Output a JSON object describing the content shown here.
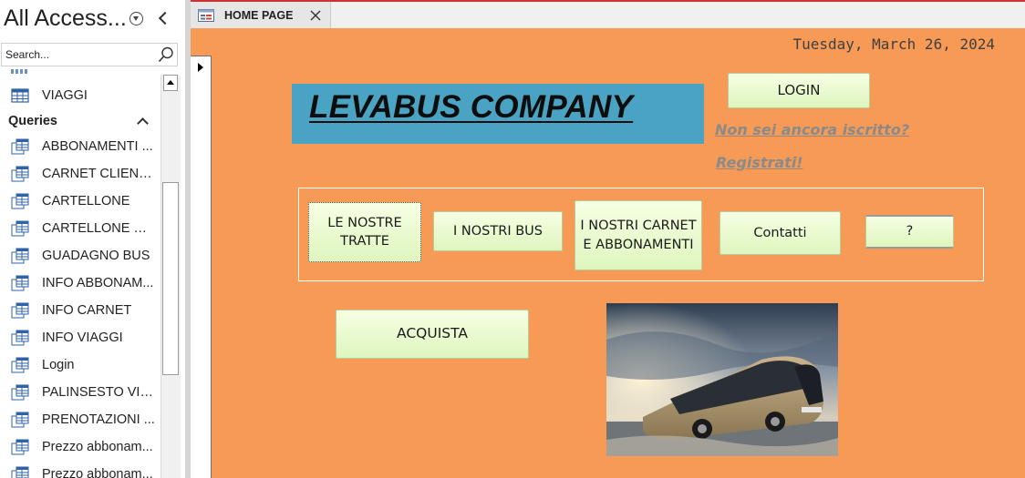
{
  "navigation_pane": {
    "title": "All Access...",
    "search_placeholder": "Search...",
    "tables": [
      {
        "label": "VIAGGI",
        "icon": "table-icon"
      }
    ],
    "queries_header": "Queries",
    "queries": [
      {
        "label": "ABBONAMENTI ...",
        "icon": "query-icon"
      },
      {
        "label": "CARNET CLIENTE",
        "icon": "query-icon"
      },
      {
        "label": "CARTELLONE",
        "icon": "query-icon"
      },
      {
        "label": "CARTELLONE VI...",
        "icon": "query-icon"
      },
      {
        "label": "GUADAGNO BUS",
        "icon": "query-icon"
      },
      {
        "label": "INFO ABBONAM...",
        "icon": "query-icon"
      },
      {
        "label": "INFO CARNET",
        "icon": "query-icon"
      },
      {
        "label": "INFO VIAGGI",
        "icon": "query-icon"
      },
      {
        "label": "Login",
        "icon": "query-icon"
      },
      {
        "label": "PALINSESTO VIA...",
        "icon": "query-icon"
      },
      {
        "label": "PRENOTAZIONI ...",
        "icon": "query-icon"
      },
      {
        "label": "Prezzo abbonam...",
        "icon": "query-icon"
      },
      {
        "label": "Prezzo abbonam...",
        "icon": "query-icon"
      }
    ]
  },
  "document_tab": {
    "label": "HOME PAGE",
    "icon": "form-icon"
  },
  "form": {
    "date": "Tuesday, March 26, 2024",
    "company_title": "LEVABUS COMPANY",
    "login_label": "LOGIN",
    "signup_prompt": "Non sei ancora iscritto? ",
    "signup_link": "Registrati!",
    "menu": {
      "tratte": "LE NOSTRE TRATTE",
      "bus": "I NOSTRI BUS",
      "carnet": "I NOSTRI CARNET E ABBONAMENTI",
      "contatti": "Contatti",
      "help": "?"
    },
    "buy_label": "ACQUISTA",
    "image": "bus-photo"
  },
  "colors": {
    "form_background": "#f79a56",
    "title_box": "#4ba3c3",
    "button_gradient_top": "#f6ffe4",
    "button_gradient_bottom": "#dff5be",
    "link_text": "#8a8a8a",
    "query_icon": "#2e63a8"
  }
}
